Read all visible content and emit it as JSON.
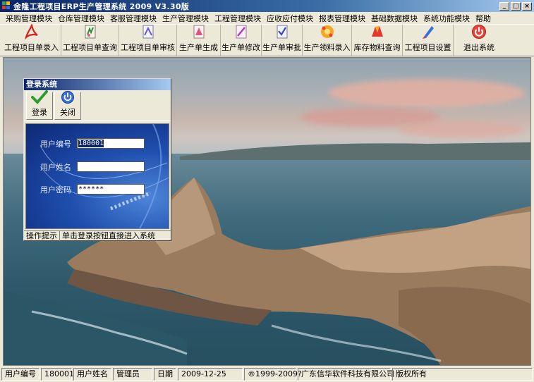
{
  "window": {
    "title": "金隆工程项目ERP生产管理系统 2009 V3.30版",
    "controls": [
      "_",
      "□",
      "×"
    ]
  },
  "menu": [
    "采购管理模块",
    "仓库管理模块",
    "客服管理模块",
    "生产管理模块",
    "工程管理模块",
    "应收应付模块",
    "报表管理模块",
    "基础数据模块",
    "系统功能模块",
    "帮助"
  ],
  "toolbar": [
    {
      "label": "工程项目单录入",
      "icon": "pdf-doc-icon"
    },
    {
      "label": "工程项目单查询",
      "icon": "doc-query-icon"
    },
    {
      "label": "工程项目单审核",
      "icon": "doc-review-icon"
    },
    {
      "label": "生产单生成",
      "icon": "doc-generate-icon"
    },
    {
      "label": "生产单修改",
      "icon": "doc-edit-icon"
    },
    {
      "label": "生产单审批",
      "icon": "doc-approve-icon"
    },
    {
      "label": "生产领料录入",
      "icon": "material-entry-icon"
    },
    {
      "label": "库存物料查询",
      "icon": "inventory-query-icon"
    },
    {
      "label": "工程项目设置",
      "icon": "pen-settings-icon"
    },
    {
      "label": "退出系统",
      "icon": "power-exit-icon"
    }
  ],
  "login": {
    "title": "登录系统",
    "login_label": "登录",
    "close_label": "关闭",
    "user_id_label": "用户编号",
    "user_id_value": "180001",
    "user_name_label": "用户姓名",
    "user_name_value": "",
    "password_label": "用户密码",
    "password_value": "******",
    "hint_label": "操作提示",
    "hint_text": "单击登录按钮直接进入系统"
  },
  "status": {
    "user_id_label": "用户编号",
    "user_id": "180001",
    "user_name_label": "用户姓名",
    "user_name": "管理员",
    "date_label": "日期",
    "date": "2009-12-25",
    "copyright": "®1999-2009?",
    "company": "广东信华软件科技有限公司",
    "rights": "版权所有"
  },
  "colors": {
    "titlebar_start": "#0a246a",
    "titlebar_end": "#a6caf0",
    "chrome": "#ece9d8",
    "login_panel": "#1f4fae"
  }
}
